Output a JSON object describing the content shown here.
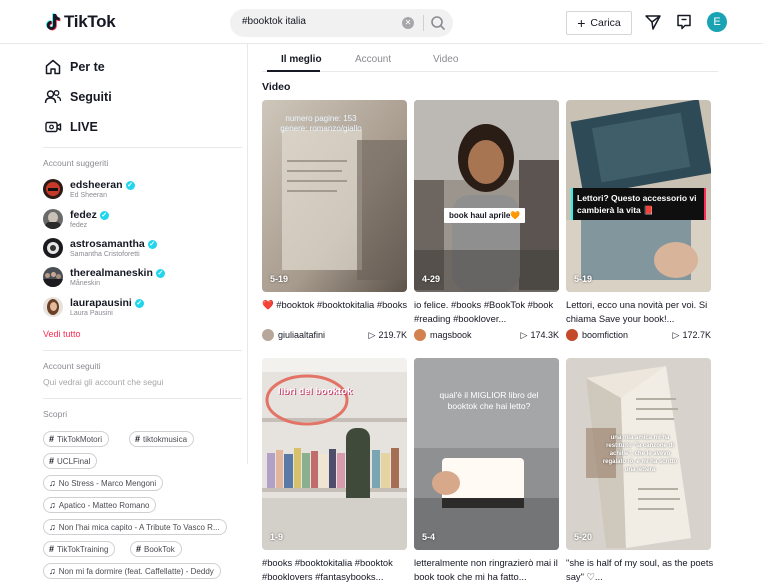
{
  "header": {
    "logo_text": "TikTok",
    "search_value": "#booktok italia",
    "upload_label": "Carica",
    "avatar_letter": "E"
  },
  "sidebar": {
    "nav": [
      {
        "label": "Per te",
        "icon": "home-icon"
      },
      {
        "label": "Seguiti",
        "icon": "following-icon"
      },
      {
        "label": "LIVE",
        "icon": "live-icon"
      }
    ],
    "suggested_title": "Account suggeriti",
    "suggested": [
      {
        "name": "edsheeran",
        "sub": "Ed Sheeran"
      },
      {
        "name": "fedez",
        "sub": "fedez"
      },
      {
        "name": "astrosamantha",
        "sub": "Samantha Cristoforetti"
      },
      {
        "name": "therealmaneskin",
        "sub": "Måneskin"
      },
      {
        "name": "laurapausini",
        "sub": "Laura Pausini"
      }
    ],
    "see_all": "Vedi tutto",
    "followed_title": "Account seguiti",
    "followed_hint": "Qui vedrai gli account che segui",
    "discover_title": "Scopri",
    "discover": [
      {
        "label": "TikTokMotori",
        "type": "hashtag"
      },
      {
        "label": "tiktokmusica",
        "type": "hashtag"
      },
      {
        "label": "UCLFinal",
        "type": "hashtag"
      },
      {
        "label": "No Stress - Marco Mengoni",
        "type": "music"
      },
      {
        "label": "Apatico - Matteo Romano",
        "type": "music"
      },
      {
        "label": "Non l'hai mica capito - A Tribute To Vasco R...",
        "type": "music"
      },
      {
        "label": "TikTokTraining",
        "type": "hashtag"
      },
      {
        "label": "BookTok",
        "type": "hashtag"
      },
      {
        "label": "Non mi fa dormire (feat. Caffellatte) - Deddy",
        "type": "music"
      }
    ]
  },
  "tabs": [
    "Il meglio",
    "Account",
    "Video"
  ],
  "section_label": "Video",
  "videos": [
    {
      "duration": "5-19",
      "overlay": "numero pagine: 153\ngenere: romanzo/giallo",
      "caption": "❤️ #booktok #booktokitalia #books",
      "user": "giuliaaltafini",
      "views": "219.7K"
    },
    {
      "duration": "4-29",
      "overlay": "book haul aprile🧡",
      "caption": "io felice. #books #BookTok #book #reading #booklover...",
      "user": "magsbook",
      "views": "174.3K"
    },
    {
      "duration": "5-19",
      "overlay": "Lettori? Questo accessorio vi cambierà la vita 📕",
      "caption": "Lettori, ecco una novità per voi. Si chiama Save your book!...",
      "user": "boomfiction",
      "views": "172.7K"
    },
    {
      "duration": "1-9",
      "overlay": "libri del booktok",
      "caption": "#books #booktokitalia #booktok #booklovers #fantasybooks...",
      "user": "",
      "views": ""
    },
    {
      "duration": "5-4",
      "overlay": "qual'è il MIGLIOR libro del booktok che hai letto?",
      "caption": "letteralmente non ringrazierò mai il book took che mi ha fatto...",
      "user": "",
      "views": ""
    },
    {
      "duration": "5-20",
      "overlay": "una mia amica mi ha restituito \"la canzone di achille\", che le avevo regalato io, e mi ha scritto una lettera",
      "caption": "\"she is half of my soul, as the poets say\" ♡...",
      "user": "",
      "views": ""
    }
  ]
}
